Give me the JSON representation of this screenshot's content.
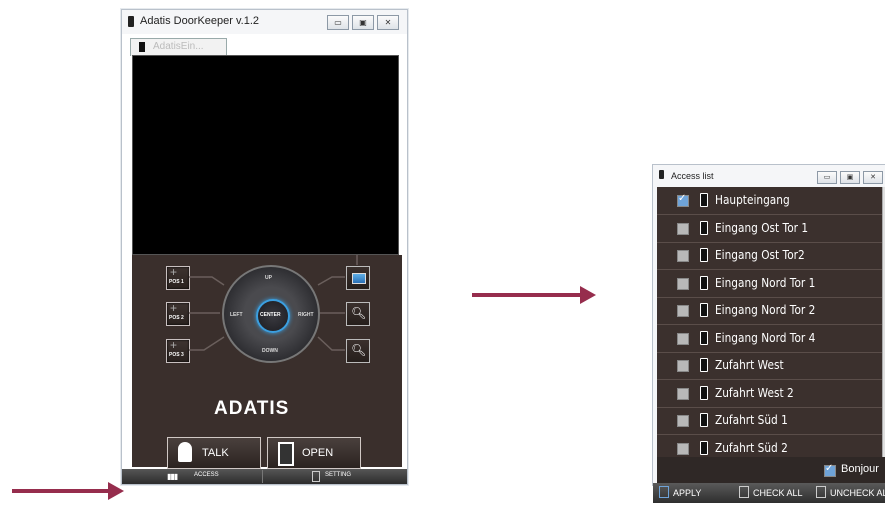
{
  "main_window": {
    "title": "Adatis DoorKeeper v.1.2",
    "controls": {
      "minimize": "▭",
      "maximize": "▣",
      "close": "✕"
    },
    "tab_label": "AdatisEin...",
    "positions": [
      "POS 1",
      "POS 2",
      "POS 3"
    ],
    "dpad": {
      "up": "UP",
      "down": "DOWN",
      "left": "LEFT",
      "right": "RIGHT",
      "center": "CENTER"
    },
    "logo": "ADATIS",
    "talk_label": "TALK",
    "open_label": "OPEN",
    "bottom_tabs": {
      "access": "ACCESS",
      "setting": "SETTING"
    }
  },
  "access_window": {
    "title": "Access list",
    "items": [
      {
        "label": "Haupteingang",
        "checked": true
      },
      {
        "label": "Eingang Ost Tor 1",
        "checked": false
      },
      {
        "label": "Eingang Ost Tor2",
        "checked": false
      },
      {
        "label": "Eingang Nord Tor 1",
        "checked": false
      },
      {
        "label": "Eingang Nord Tor 2",
        "checked": false
      },
      {
        "label": "Eingang Nord Tor 4",
        "checked": false
      },
      {
        "label": "Zufahrt West",
        "checked": false
      },
      {
        "label": "Zufahrt West 2",
        "checked": false
      },
      {
        "label": "Zufahrt Süd 1",
        "checked": false
      },
      {
        "label": "Zufahrt Süd 2",
        "checked": false
      }
    ],
    "footer_check": {
      "label": "Bonjour",
      "checked": true
    },
    "actions": {
      "apply": "APPLY",
      "check_all": "CHECK ALL",
      "uncheck_all": "UNCHECK ALL"
    }
  },
  "colors": {
    "arrow": "#962d4d",
    "panel": "#3a2f2c",
    "accent": "#3b9fe0"
  }
}
